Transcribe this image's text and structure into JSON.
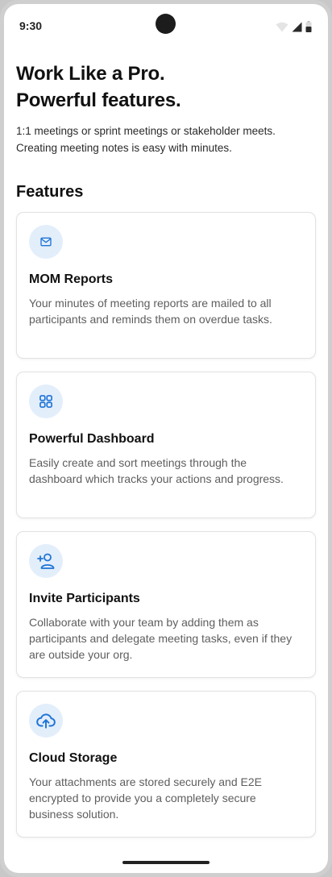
{
  "status_bar": {
    "time": "9:30",
    "icons": [
      "wifi-icon",
      "signal-icon",
      "battery-icon"
    ]
  },
  "hero": {
    "title_line1": "Work Like a Pro.",
    "title_line2": "Powerful features.",
    "subtitle_line1": "1:1 meetings or sprint meetings or stakeholder meets.",
    "subtitle_line2": "Creating meeting notes is easy with minutes."
  },
  "features": {
    "heading": "Features",
    "items": [
      {
        "icon": "mail-icon",
        "title": "MOM Reports",
        "description": "Your minutes of meeting reports are mailed to all participants and reminds them on overdue tasks."
      },
      {
        "icon": "dashboard-grid-icon",
        "title": "Powerful Dashboard",
        "description": "Easily create and sort meetings through the dashboard which tracks your actions and progress."
      },
      {
        "icon": "add-user-icon",
        "title": "Invite Participants",
        "description": "Collaborate with your team by adding them as participants and delegate meeting tasks, even if they are outside your org."
      },
      {
        "icon": "cloud-upload-icon",
        "title": "Cloud Storage",
        "description": "Your attachments are stored securely and E2E encrypted to provide you a completely secure business solution."
      }
    ]
  },
  "colors": {
    "accent": "#1f74d6",
    "icon_background": "#e3eefb",
    "card_border": "#e2e2e2",
    "body_text": "#5e5e5e"
  }
}
